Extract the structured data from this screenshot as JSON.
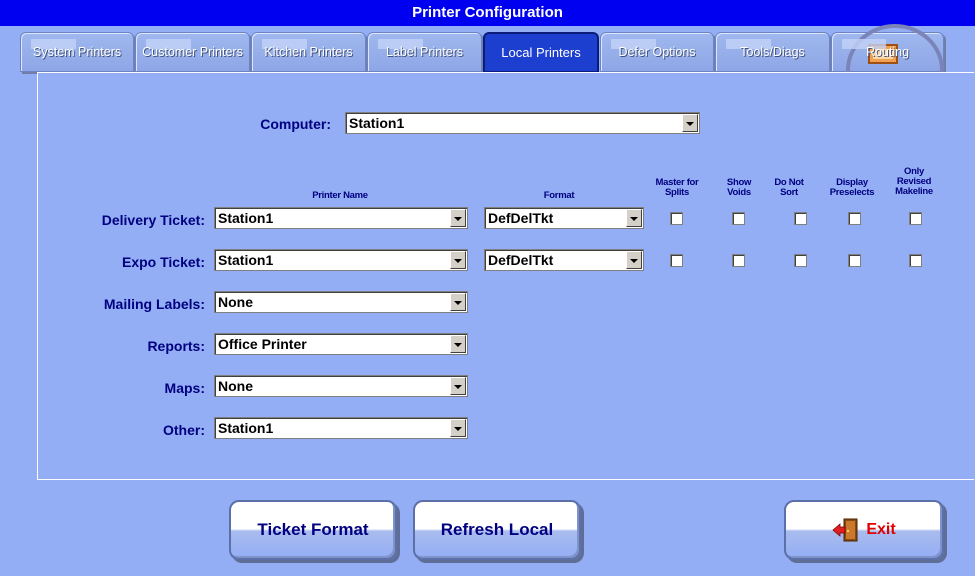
{
  "window": {
    "title": "Printer Configuration"
  },
  "tabs": [
    {
      "label": "System Printers",
      "active": false
    },
    {
      "label": "Customer Printers",
      "active": false
    },
    {
      "label": "Kitchen Printers",
      "active": false
    },
    {
      "label": "Label Printers",
      "active": false
    },
    {
      "label": "Local Printers",
      "active": true
    },
    {
      "label": "Defer Options",
      "active": false
    },
    {
      "label": "Tools/Diags",
      "active": false
    },
    {
      "label": "Routing",
      "active": false
    }
  ],
  "computer": {
    "label": "Computer:",
    "value": "Station1"
  },
  "columns": {
    "printer_name": "Printer Name",
    "format": "Format",
    "master_for_splits": "Master for Splits",
    "show_voids": "Show Voids",
    "do_not_sort": "Do Not Sort",
    "display_preselects": "Display Preselects",
    "only_revised_makeline": "Only Revised Makeline"
  },
  "rows": {
    "delivery_ticket": {
      "label": "Delivery Ticket:",
      "printer": "Station1",
      "format": "DefDelTkt",
      "master_for_splits": false,
      "show_voids": false,
      "do_not_sort": false,
      "display_preselects": false,
      "only_revised_makeline": false
    },
    "expo_ticket": {
      "label": "Expo Ticket:",
      "printer": "Station1",
      "format": "DefDelTkt",
      "master_for_splits": false,
      "show_voids": false,
      "do_not_sort": false,
      "display_preselects": false,
      "only_revised_makeline": false
    },
    "mailing_labels": {
      "label": "Mailing Labels:",
      "printer": "None"
    },
    "reports": {
      "label": "Reports:",
      "printer": "Office Printer"
    },
    "maps": {
      "label": "Maps:",
      "printer": "None"
    },
    "other": {
      "label": "Other:",
      "printer": "Station1"
    }
  },
  "buttons": {
    "ticket_format": "Ticket Format",
    "refresh_local": "Refresh Local",
    "exit": "Exit"
  },
  "icons": {
    "exit": "exit-door-icon",
    "routing": "routing-computers-icon",
    "dropdown": "chevron-down-icon"
  },
  "colors": {
    "background": "#94aef5",
    "titlebar": "#0000f0",
    "label_text": "#000080",
    "active_tab": "#1d3fd0",
    "exit_text": "#e00000"
  }
}
